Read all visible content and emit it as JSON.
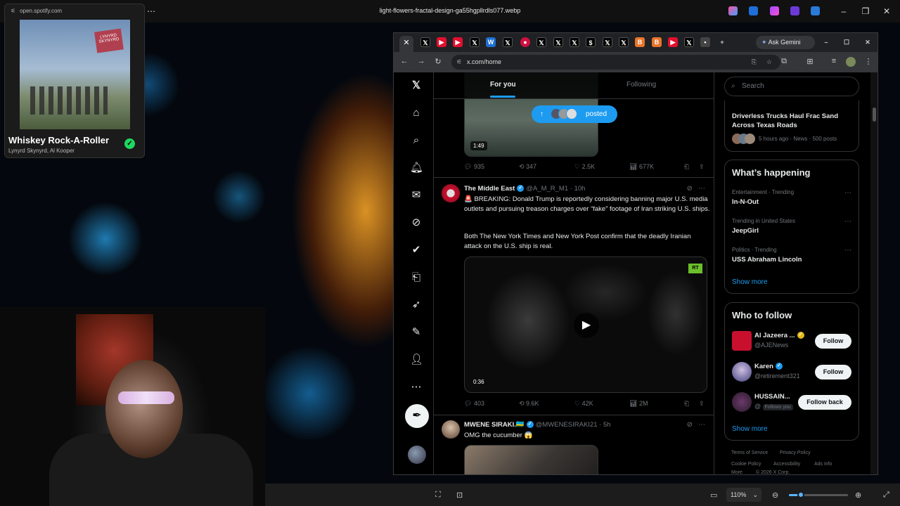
{
  "viewer": {
    "title": "light-flowers-fractal-design-ga55hgpllrdls077.webp",
    "zoom": "110%",
    "zoom_fraction": 0.2
  },
  "spotify": {
    "url": "open.spotify.com",
    "album_text": "LYNYRD SKYNYRD",
    "track": "Whiskey Rock-A-Roller",
    "artists": "Lynyrd Skynyrd, Al Kooper"
  },
  "browser": {
    "ask_gemini": "Ask Gemini",
    "url": "x.com/home"
  },
  "feed": {
    "tabs": [
      "For you",
      "Following"
    ],
    "posted_label": "posted",
    "tweet1": {
      "video_time": "1:49",
      "stats": {
        "replies": "935",
        "reposts": "347",
        "likes": "2.5K",
        "views": "677K"
      }
    },
    "tweet2": {
      "name": "The Middle East",
      "handle": "@A_M_R_M1",
      "time": "· 10h",
      "text_line1": "🚨 BREAKING: Donald Trump is reportedly considering banning major U.S. media outlets and pursuing treason charges over “fake” footage of Iran striking U.S. ships.",
      "text_line2": "Both The New York Times and New York Post confirm that the deadly Iranian attack on the U.S. ship is real.",
      "video_badge": "RT",
      "video_time": "0:36",
      "stats": {
        "replies": "403",
        "reposts": "9.6K",
        "likes": "42K",
        "views": "2M"
      }
    },
    "tweet3": {
      "name": "MWENE SIRAKI.🇷🇼",
      "handle": "@MWENESIRAKI21",
      "time": "· 5h",
      "text": "OMG the cucumber 😱"
    }
  },
  "right": {
    "search_placeholder": "Search",
    "news": {
      "headline": "Driverless Trucks Haul Frac Sand Across Texas Roads",
      "meta": "5 hours ago · News · 500 posts"
    },
    "whats_happening": {
      "title": "What’s happening",
      "items": [
        {
          "category": "Entertainment · Trending",
          "name": "In-N-Out"
        },
        {
          "category": "Trending in United States",
          "name": "JeepGirl"
        },
        {
          "category": "Politics · Trending",
          "name": "USS Abraham Lincoln"
        }
      ],
      "show_more": "Show more"
    },
    "who_to_follow": {
      "title": "Who to follow",
      "accounts": [
        {
          "name": "Al Jazeera ...",
          "handle": "@AJENews",
          "button": "Follow"
        },
        {
          "name": "Karen",
          "handle": "@retirement321",
          "button": "Follow"
        },
        {
          "name": "HUSSAIN...",
          "handle": "@",
          "follows_you": "Follows you",
          "button": "Follow back"
        }
      ],
      "show_more": "Show more"
    },
    "footer": {
      "terms": "Terms of Service",
      "privacy": "Privacy Policy",
      "cookie": "Cookie Policy",
      "accessibility": "Accessibility",
      "ads": "Ads info",
      "more": "More",
      "copyright": "© 2026 X Corp."
    }
  }
}
